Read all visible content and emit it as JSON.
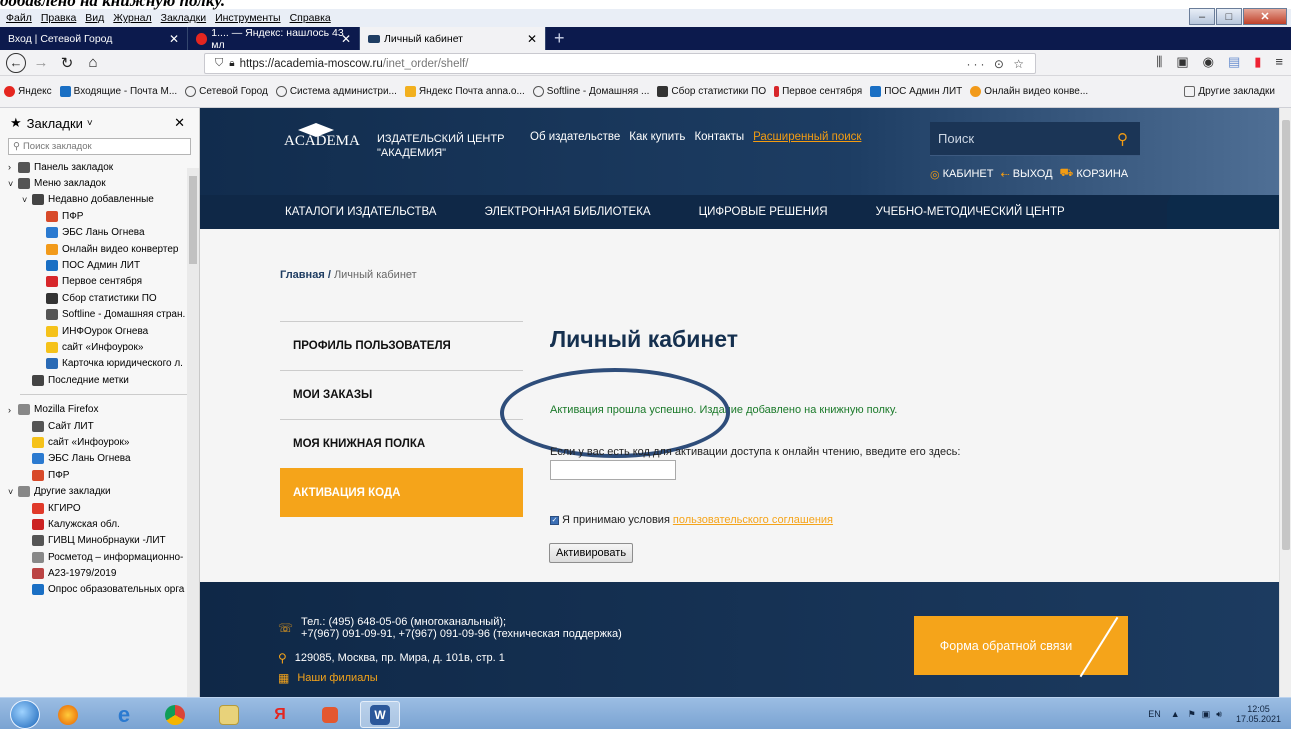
{
  "caption": "добавлено на книжную полку.",
  "menubar": {
    "items": [
      "Файл",
      "Правка",
      "Вид",
      "Журнал",
      "Закладки",
      "Инструменты",
      "Справка"
    ]
  },
  "tabs": [
    {
      "label": "Вход | Сетевой Город",
      "active": false
    },
    {
      "label": "1.... — Яндекс: нашлось 43 мл",
      "active": false
    },
    {
      "label": "Личный кабинет",
      "active": true
    }
  ],
  "navbar": {
    "url_host": "https://academia-moscow.ru",
    "url_path": "/inet_order/shelf/",
    "page_actions": "··· ⊙ ☆"
  },
  "bookmarks_bar": [
    {
      "label": "Яндекс",
      "color": "#e52620"
    },
    {
      "label": "Входящие - Почта М...",
      "color": "#1a6fc4"
    },
    {
      "label": "Сетевой Город",
      "color": "#555"
    },
    {
      "label": "Система администри...",
      "color": "#555"
    },
    {
      "label": "Яндекс Почта anna.o...",
      "color": "#f2b01e"
    },
    {
      "label": "Softline - Домашняя ...",
      "color": "#555"
    },
    {
      "label": "Сбор статистики ПО",
      "color": "#333"
    },
    {
      "label": "Первое сентября",
      "color": "#d7262a"
    },
    {
      "label": "ПОС Админ ЛИТ",
      "color": "#1a6fc4"
    },
    {
      "label": "Онлайн видео конве...",
      "color": "#f29a1a"
    }
  ],
  "other_bookmarks": "Другие закладки",
  "sidebar": {
    "title": "Закладки",
    "search_placeholder": "Поиск закладок",
    "items": [
      {
        "label": "Панель закладок",
        "indent": 0,
        "caret": "›",
        "color": "#555"
      },
      {
        "label": "Меню закладок",
        "indent": 0,
        "caret": "˅",
        "color": "#555"
      },
      {
        "label": "Недавно добавленные",
        "indent": 1,
        "caret": "˅",
        "color": "#444"
      },
      {
        "label": "ПФР",
        "indent": 2,
        "caret": "",
        "color": "#d84a2a"
      },
      {
        "label": "ЭБС Лань Огнева",
        "indent": 2,
        "caret": "",
        "color": "#2b7ad0"
      },
      {
        "label": "Онлайн видео конвертер",
        "indent": 2,
        "caret": "",
        "color": "#f29a1a"
      },
      {
        "label": "ПОС Админ ЛИТ",
        "indent": 2,
        "caret": "",
        "color": "#1a6fc4"
      },
      {
        "label": "Первое сентября",
        "indent": 2,
        "caret": "",
        "color": "#d7262a"
      },
      {
        "label": "Сбор статистики ПО",
        "indent": 2,
        "caret": "",
        "color": "#333"
      },
      {
        "label": "Softline - Домашняя стран.",
        "indent": 2,
        "caret": "",
        "color": "#555"
      },
      {
        "label": "ИНФОурок Огнева",
        "indent": 2,
        "caret": "",
        "color": "#f5c21a"
      },
      {
        "label": "сайт «Инфоурок»",
        "indent": 2,
        "caret": "",
        "color": "#f5c21a"
      },
      {
        "label": "Карточка юридического л.",
        "indent": 2,
        "caret": "",
        "color": "#2a6ab5"
      },
      {
        "label": "Последние метки",
        "indent": 1,
        "caret": "",
        "color": "#444"
      }
    ],
    "items2": [
      {
        "label": "Mozilla Firefox",
        "indent": 0,
        "caret": "›",
        "color": "#888"
      },
      {
        "label": "Сайт ЛИТ",
        "indent": 1,
        "caret": "",
        "color": "#555"
      },
      {
        "label": "сайт «Инфоурок»",
        "indent": 1,
        "caret": "",
        "color": "#f5c21a"
      },
      {
        "label": "ЭБС Лань Огнева",
        "indent": 1,
        "caret": "",
        "color": "#2b7ad0"
      },
      {
        "label": "ПФР",
        "indent": 1,
        "caret": "",
        "color": "#d84a2a"
      },
      {
        "label": "Другие закладки",
        "indent": 0,
        "caret": "˅",
        "color": "#888"
      },
      {
        "label": "КГИРО",
        "indent": 1,
        "caret": "",
        "color": "#e03a2a"
      },
      {
        "label": "Калужская обл.",
        "indent": 1,
        "caret": "",
        "color": "#c22"
      },
      {
        "label": "ГИВЦ Минобрнауки -ЛИТ",
        "indent": 1,
        "caret": "",
        "color": "#555"
      },
      {
        "label": "Росметод – информационно-",
        "indent": 1,
        "caret": "",
        "color": "#888"
      },
      {
        "label": "А23-1979/2019",
        "indent": 1,
        "caret": "",
        "color": "#b44"
      },
      {
        "label": "Опрос образовательных орга",
        "indent": 1,
        "caret": "",
        "color": "#1a6fc4"
      }
    ]
  },
  "site": {
    "logo": "ACADEMA",
    "publisher_line1": "ИЗДАТЕЛЬСКИЙ ЦЕНТР",
    "publisher_line2": "\"АКАДЕМИЯ\"",
    "topnav": [
      "Об издательстве",
      "Как купить",
      "Контакты"
    ],
    "advanced_search": "Расширенный поиск",
    "search_placeholder": "Поиск",
    "account": "КАБИНЕТ",
    "logout": "ВЫХОД",
    "cart": "КОРЗИНА",
    "catalog_nav": [
      "КАТАЛОГИ ИЗДАТЕЛЬСТВА",
      "ЭЛЕКТРОННАЯ БИБЛИОТЕКА",
      "ЦИФРОВЫЕ РЕШЕНИЯ",
      "УЧЕБНО-МЕТОДИЧЕСКИЙ ЦЕНТР"
    ],
    "breadcrumb_home": "Главная",
    "breadcrumb_sep": "/",
    "breadcrumb_current": "Личный кабинет",
    "left_menu": [
      {
        "label": "ПРОФИЛЬ ПОЛЬЗОВАТЕЛЯ",
        "active": false
      },
      {
        "label": "МОИ ЗАКАЗЫ",
        "active": false
      },
      {
        "label": "МОЯ КНИЖНАЯ ПОЛКА",
        "active": false
      },
      {
        "label": "АКТИВАЦИЯ КОДА",
        "active": true
      }
    ],
    "page_title": "Личный кабинет",
    "success_message": "Активация прошла успешно. Издание добавлено на книжную полку.",
    "code_prompt": "Если у вас есть код для активации доступа к онлайн чтению, введите его здесь:",
    "code_value": "",
    "agree_text": "Я принимаю условия",
    "agree_link": "пользовательского соглашения",
    "agree_checked": true,
    "activate_button": "Активировать",
    "footer_phone1": "Тел.: (495) 648-05-06 (многоканальный);",
    "footer_phone2": "+7(967) 091-09-91, +7(967) 091-09-96 (техническая поддержка)",
    "footer_address": "129085, Москва, пр. Мира, д. 101в, стр. 1",
    "footer_branches": "Наши филиалы",
    "feedback_button": "Форма обратной связи"
  },
  "taskbar": {
    "lang": "EN",
    "time": "12:05",
    "date": "17.05.2021"
  },
  "colors": {
    "accent": "#f5a41a",
    "site_dark": "#0f2847",
    "success": "#1b7a2a"
  }
}
